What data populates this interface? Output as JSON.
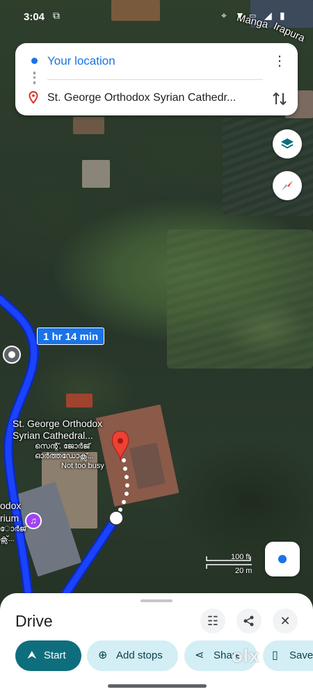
{
  "status_bar": {
    "time": "3:04"
  },
  "directions": {
    "origin": "Your location",
    "destination": "St. George Orthodox Syrian Cathedr...",
    "more_label": "⋮",
    "swap_label": "⇅"
  },
  "map": {
    "road_labels": [
      "Manga",
      "Irapura"
    ],
    "eta": "1 hr 14 min",
    "place_name_line1": "St. George Orthodox",
    "place_name_line2": "Syrian Cathedral...",
    "place_local_line1": "സെന്റ്. ജോർജ്",
    "place_local_line2": "ഓർത്തഡോക്സ്...",
    "place_status": "Not too busy",
    "left_place_line1": "odox",
    "left_place_line2": "rium",
    "left_place_local_line1": "ോർജ്",
    "left_place_local_line2": "ക്സ്...",
    "scale_ft": "100 ft",
    "scale_m": "20 m"
  },
  "sheet": {
    "title": "Drive",
    "filter_icon": "☷",
    "share_icon": "⋖",
    "close_icon": "✕",
    "actions": [
      {
        "label": "Start",
        "icon": "navigation-arrow-icon"
      },
      {
        "label": "Add stops",
        "icon": "add-location-icon"
      },
      {
        "label": "Share",
        "icon": "share-icon"
      },
      {
        "label": "Save",
        "icon": "bookmark-icon"
      }
    ]
  },
  "watermark": "olx",
  "colors": {
    "route": "#1a42ff",
    "accent": "#1a73e8",
    "start_chip": "#0f6e7d",
    "chip": "#d3eef5",
    "destination_pin": "#ea4335"
  }
}
